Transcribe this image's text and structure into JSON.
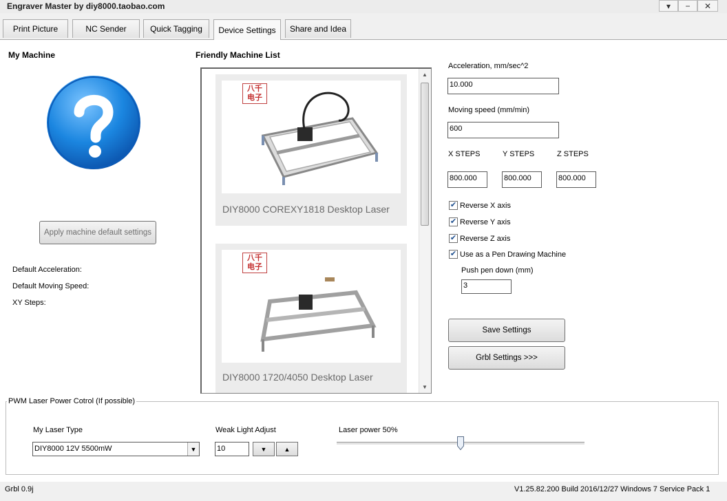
{
  "window": {
    "title": "Engraver Master by diy8000.taobao.com",
    "controls": [
      "▾",
      "−",
      "✕"
    ]
  },
  "tabs": [
    {
      "label": "Print Picture",
      "active": false
    },
    {
      "label": "NC Sender",
      "active": false
    },
    {
      "label": "Quick Tagging",
      "active": false
    },
    {
      "label": "Device Settings",
      "active": true
    },
    {
      "label": "Share and Idea",
      "active": false
    }
  ],
  "my_machine": {
    "heading": "My Machine",
    "icon": "question-mark-icon",
    "apply_button": "Apply machine default settings",
    "default_acceleration_label": "Default Acceleration:",
    "default_moving_speed_label": "Default Moving Speed:",
    "xy_steps_label": "XY Steps:"
  },
  "machine_list": {
    "heading": "Friendly Machine List",
    "stamp": "八千 电子",
    "items": [
      {
        "name": "DIY8000 COREXY1818 Desktop Laser"
      },
      {
        "name": "DIY8000 1720/4050 Desktop Laser"
      }
    ]
  },
  "settings": {
    "acceleration_label": "Acceleration, mm/sec^2",
    "acceleration_value": "10.000",
    "moving_speed_label": "Moving speed  (mm/min)",
    "moving_speed_value": "600",
    "x_steps_label": "X STEPS",
    "y_steps_label": "Y STEPS",
    "z_steps_label": "Z STEPS",
    "x_steps_value": "800.000",
    "y_steps_value": "800.000",
    "z_steps_value": "800.000",
    "checkboxes": [
      {
        "label": "Reverse X axis",
        "checked": true
      },
      {
        "label": "Reverse Y axis",
        "checked": true
      },
      {
        "label": "Reverse Z axis",
        "checked": true
      },
      {
        "label": "Use as a Pen Drawing Machine",
        "checked": true
      }
    ],
    "push_pen_label": "Push pen down (mm)",
    "push_pen_value": "3",
    "save_button": "Save Settings",
    "grbl_button": "Grbl Settings >>>"
  },
  "pwm": {
    "group_title": "PWM Laser Power Cotrol (If possible)",
    "laser_type_label": "My Laser Type",
    "laser_type_value": "DIY8000 12V 5500mW",
    "weak_light_label": "Weak Light Adjust",
    "weak_light_value": "10",
    "laser_power_label": "Laser power 50%",
    "laser_power_fraction": 0.5
  },
  "status": {
    "left": "Grbl 0.9j",
    "right": "V1.25.82.200 Build 2016/12/27 Windows 7 Service Pack 1"
  }
}
